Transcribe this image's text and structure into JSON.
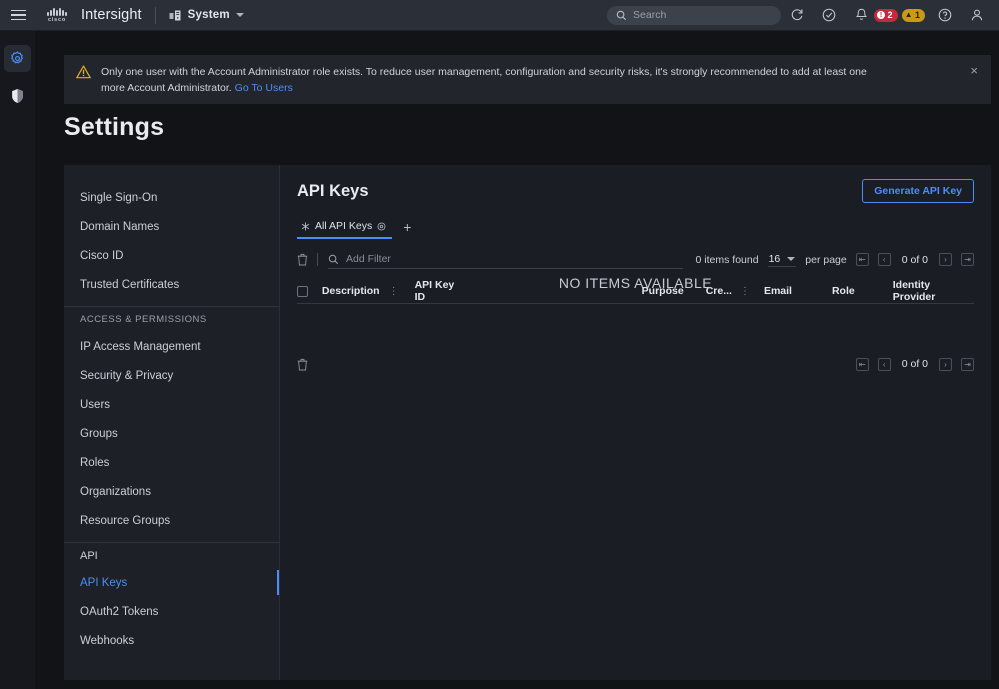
{
  "topnav": {
    "menu_icon": "hamburger-icon",
    "logo": "cisco-logo",
    "logo_word": "cisco",
    "brand": "Intersight",
    "scope": "System",
    "search_placeholder": "Search",
    "icons": [
      "refresh-icon",
      "check-circle-icon",
      "bell-icon",
      "help-icon",
      "user-avatar-icon"
    ],
    "critical_count": "2",
    "critical_symbol": "!",
    "warning_count": "1",
    "warning_symbol": "⚠"
  },
  "rail": {
    "items": [
      {
        "name": "settings-gear-icon",
        "active": true
      },
      {
        "name": "contrast-shield-icon",
        "active": false
      }
    ]
  },
  "alert": {
    "icon": "warning-triangle-icon",
    "message": "Only one user with the Account Administrator role exists. To reduce user management, configuration and security risks, it's strongly recommended to add at least one more Account Administrator. ",
    "link": "Go To Users",
    "close": "×"
  },
  "page": {
    "title": "Settings"
  },
  "sidebar": {
    "items": [
      {
        "label": "Single Sign-On",
        "type": "item"
      },
      {
        "label": "Domain Names",
        "type": "item"
      },
      {
        "label": "Cisco ID",
        "type": "item"
      },
      {
        "label": "Trusted Certificates",
        "type": "item"
      },
      {
        "label": "ACCESS & PERMISSIONS",
        "type": "section"
      },
      {
        "label": "IP Access Management",
        "type": "item"
      },
      {
        "label": "Security & Privacy",
        "type": "item"
      },
      {
        "label": "Users",
        "type": "item"
      },
      {
        "label": "Groups",
        "type": "item"
      },
      {
        "label": "Roles",
        "type": "item"
      },
      {
        "label": "Organizations",
        "type": "item"
      },
      {
        "label": "Resource Groups",
        "type": "item"
      },
      {
        "label": "API",
        "type": "section-api"
      },
      {
        "label": "API Keys",
        "type": "item",
        "selected": true
      },
      {
        "label": "OAuth2 Tokens",
        "type": "item"
      },
      {
        "label": "Webhooks",
        "type": "item"
      }
    ]
  },
  "main": {
    "title": "API Keys",
    "generate_button": "Generate API Key",
    "tab": {
      "star_icon": "star-icon",
      "label": "All API Keys",
      "settings_icon": "gear-small-icon",
      "add_icon": "plus-icon",
      "add_label": "+"
    },
    "toolbar": {
      "delete_icon": "trash-icon",
      "search_icon": "search-icon",
      "filter_placeholder": "Add Filter",
      "items_found": "0 items found",
      "per_page_value": "16",
      "per_page_label": "per page",
      "page_count": "0 of 0",
      "first_icon": "❘◀",
      "prev_icon": "◀",
      "next_icon": "▶",
      "last_icon": "▶❘"
    },
    "table": {
      "columns": [
        {
          "label": "Description",
          "kebab": true
        },
        {
          "label": "API Key ID",
          "kebab": false
        },
        {
          "label": "Purpose",
          "kebab": false
        },
        {
          "label": "Cre...",
          "kebab": true
        },
        {
          "label": "Email",
          "kebab": false
        },
        {
          "label": "Role",
          "kebab": false
        },
        {
          "label": "Identity Provider",
          "kebab": false
        }
      ],
      "rows": [],
      "empty_message": "NO ITEMS AVAILABLE"
    },
    "footer": {
      "delete_icon": "trash-icon",
      "page_count": "0 of 0"
    }
  },
  "colors": {
    "accent": "#4c8ef7",
    "critical": "#c3293f",
    "warning": "#c99a16",
    "bg": "#121317",
    "card": "#1a1d23"
  }
}
